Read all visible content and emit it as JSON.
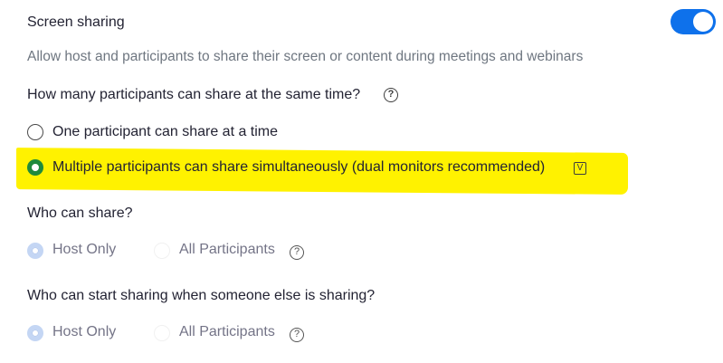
{
  "section": {
    "title": "Screen sharing",
    "description": "Allow host and participants to share their screen or content during meetings and webinars",
    "toggle_on": true,
    "accent_color": "#0e71eb"
  },
  "how_many": {
    "question": "How many participants can share at the same time?",
    "help_icon": "question-circle-icon",
    "options": [
      {
        "label": "One participant can share at a time",
        "selected": false
      },
      {
        "label": "Multiple participants can share simultaneously (dual monitors recommended)",
        "selected": true,
        "extra_icon": "v-badge-icon",
        "extra_icon_glyph": "V"
      }
    ],
    "highlight_color": "#fff200"
  },
  "who_can_share": {
    "question": "Who can share?",
    "options": [
      {
        "label": "Host Only",
        "selected": true
      },
      {
        "label": "All Participants",
        "selected": false
      }
    ],
    "help_icon": "question-circle-icon"
  },
  "who_can_start": {
    "question": "Who can start sharing when someone else is sharing?",
    "options": [
      {
        "label": "Host Only",
        "selected": true
      },
      {
        "label": "All Participants",
        "selected": false
      }
    ],
    "help_icon": "question-circle-icon"
  },
  "help_glyph": "?"
}
